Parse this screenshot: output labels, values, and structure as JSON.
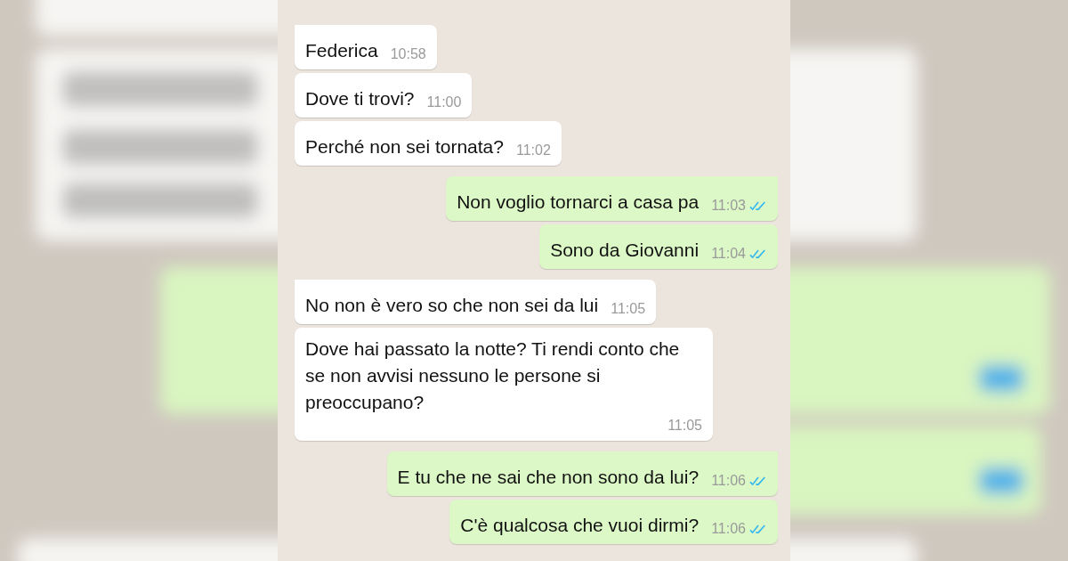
{
  "messages": [
    {
      "kind": "incoming",
      "tail": true,
      "text": "Federica",
      "time": "10:58"
    },
    {
      "kind": "incoming",
      "tail": false,
      "text": "Dove ti trovi?",
      "time": "11:00"
    },
    {
      "kind": "incoming",
      "tail": false,
      "text": "Perché non sei tornata?",
      "time": "11:02"
    },
    {
      "kind": "outgoing",
      "tail": true,
      "text": "Non voglio tornarci a casa pa",
      "time": "11:03",
      "read": true
    },
    {
      "kind": "outgoing",
      "tail": false,
      "text": "Sono da Giovanni",
      "time": "11:04",
      "read": true
    },
    {
      "kind": "incoming",
      "tail": true,
      "text": "No non è vero so che non sei da lui",
      "time": "11:05"
    },
    {
      "kind": "incoming",
      "tail": false,
      "text": "Dove hai passato la notte? Ti rendi conto che se non avvisi nessuno le persone si preoccupano?",
      "time": "11:05"
    },
    {
      "kind": "outgoing",
      "tail": true,
      "text": "E tu che ne sai che non sono da lui?",
      "time": "11:06",
      "read": true
    },
    {
      "kind": "outgoing",
      "tail": false,
      "text": "C'è qualcosa che vuoi dirmi?",
      "time": "11:06",
      "read": true
    }
  ]
}
